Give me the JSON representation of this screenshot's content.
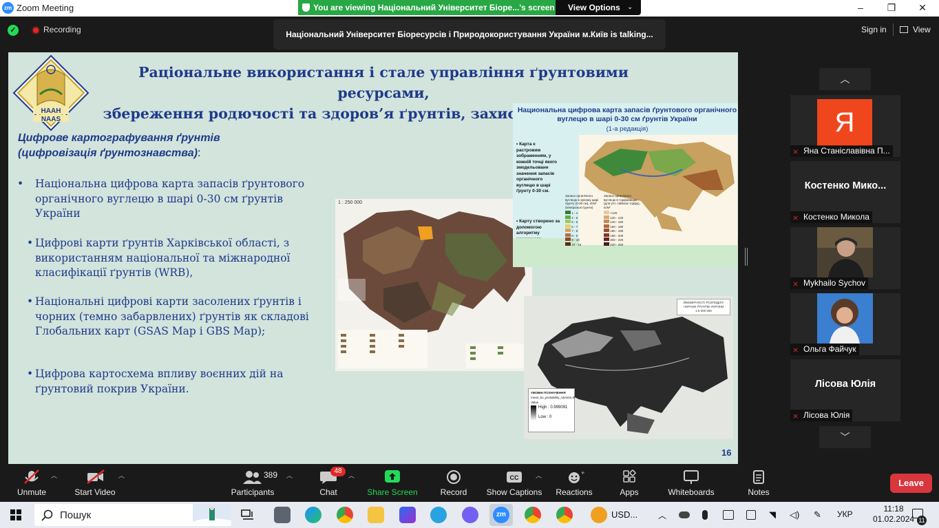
{
  "window": {
    "app_icon": "zm",
    "title": "Zoom Meeting",
    "banner": "You are viewing Національний Університет Біоре...'s screen",
    "view_options": "View Options"
  },
  "meeting_bar": {
    "recording": "Recording",
    "talking": "Національний Університет Біоресурсів і Природокористування України м.Київ is talking...",
    "sign_in": "Sign in",
    "view": "View"
  },
  "slide": {
    "logo_top": "НААН",
    "logo_bottom": "NAAS",
    "title_line1": "Раціональне використання і стале управління ґрунтовими ресурсами,",
    "title_line2": "збереження родючості та здоров’я ґрунтів, захист їх від деградації",
    "subtitle": "Цифрове картографування ґрунтів (цифровізація ґрунтознавства)",
    "subtitle_colon": ":",
    "bullets": [
      "Національна цифрова карта запасів ґрунтового органічного вуглецю  в шарі 0-30 см ґрунтів України",
      "Цифрові карти ґрунтів Харківської області, з використанням національної та міжнародної класифікації ґрунтів (WRB),",
      "Національні цифрові карти засолених ґрунтів і чорних (темно забарвлених) ґрунтів як складові Глобальних карт (GSAS Map і GBS Map);",
      "Цифрова картосхема впливу воєнних дій на ґрунтовий покрив України."
    ],
    "bullet_marks": [
      "•",
      "•",
      "•",
      "•"
    ],
    "page_number": "16",
    "map1_scale": "1 : 250 000",
    "map2": {
      "title": "Национальна цифрова карта запасів ґрунтового органічного вуглецю  в шарі 0-30 см ґрунтів України",
      "edition": "(1-а редакція)",
      "note1": "Карта є растровим зображенням, у кожній точці якого змодельоване значення запасів органічного вуглецю в шарі ґрунту 0-30 см.",
      "note2": "Карту створено за допомогою алгоритму машинного навчання Random Forest.",
      "legend1_title": "Запаси органічного вуглецю в орному шарі ґрунту (0-30 см), кг/м² (мінеральні ґрунти)",
      "legend1": [
        "1 - 4",
        "4 - 5",
        "5 - 6",
        "6 - 7",
        "7 - 8",
        "8 - 9",
        "9 - 10",
        "10 - 15"
      ],
      "legend2_title": "Запаси органічного вуглецю в торфовищах (для угіт. сівбною торфу), кг/м²",
      "legend2": [
        "<120",
        "120 - 140",
        "140 - 160",
        "160 - 180",
        "180 - 190",
        "190 - 200",
        "200 - 220",
        "220 - 260"
      ]
    },
    "map3": {
      "title": "ЙМОВІРНОСТІ РОЗПОДІЛУ ЧОРНИХ ҐРУНТІВ УКРАЇНИ",
      "scale": "1:5 000 000",
      "legend_title": "УМОВНІ ПОЗНАЧЕННЯ",
      "layer": "mean_bs_probability_Ukraine.tif",
      "value_label": "Value",
      "high": "High : 0.999091",
      "low": "Low : 0"
    }
  },
  "panel": {
    "participants": [
      {
        "name": "Яна Станіславівна П...",
        "avatar_letter": "Я",
        "muted": true
      },
      {
        "name": "Костенко Микола",
        "big_name": "Костенко  Мико...",
        "muted": true
      },
      {
        "name": "Mykhailo Sychov",
        "muted": true
      },
      {
        "name": "Ольга Файчук",
        "muted": true
      },
      {
        "name": "Лісова Юлія",
        "big_name": "Лісова Юлія",
        "muted": true
      }
    ]
  },
  "toolbar": {
    "unmute": "Unmute",
    "start_video": "Start Video",
    "participants_count": "389",
    "participants": "Participants",
    "chat_badge": "48",
    "chat": "Chat",
    "share_screen": "Share Screen",
    "record": "Record",
    "show_captions": "Show Captions",
    "reactions": "Reactions",
    "apps": "Apps",
    "whiteboards": "Whiteboards",
    "notes": "Notes",
    "leave": "Leave"
  },
  "taskbar": {
    "search_placeholder": "Пошук",
    "zoom_label": "zm",
    "currency": "USD...",
    "language": "УКР",
    "time": "11:18",
    "date": "01.02.2024",
    "notifications": "11"
  },
  "colors": {
    "slide_bg": "#d2e4dc",
    "slide_text": "#1f3a8a",
    "share_green": "#23d959",
    "leave_red": "#d9363e",
    "banner_green": "#28a745"
  }
}
